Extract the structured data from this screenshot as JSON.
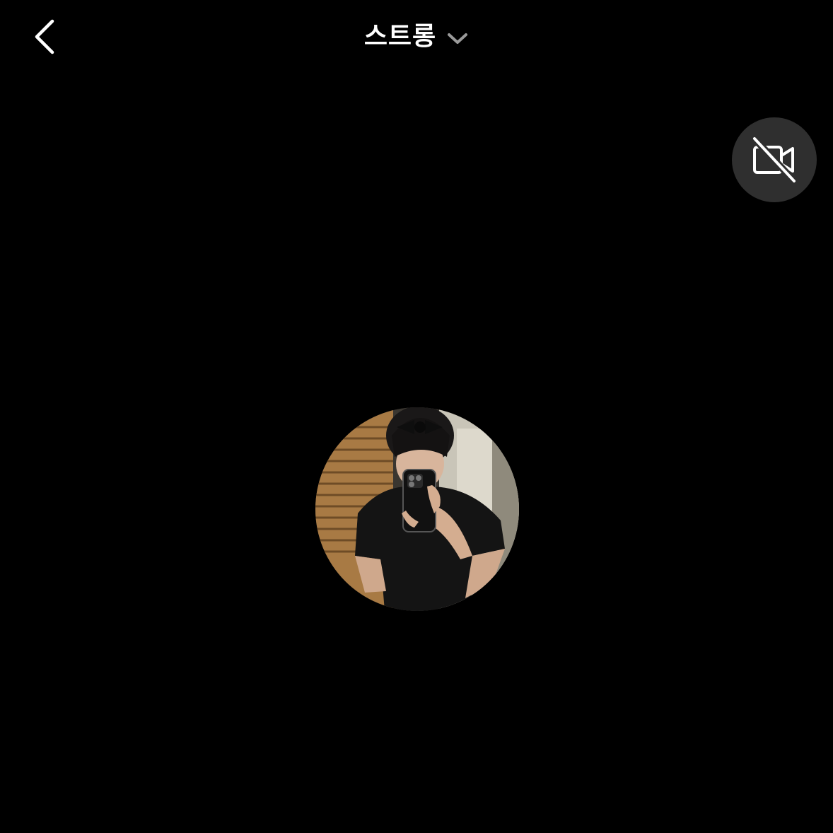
{
  "header": {
    "title": "스트롱",
    "back_icon": "chevron-left-icon",
    "dropdown_icon": "chevron-down-icon"
  },
  "controls": {
    "camera_toggle_icon": "video-off-icon",
    "camera_enabled": false
  },
  "colors": {
    "background": "#000000",
    "text": "#ffffff",
    "chevron": "#9a9a9a",
    "control_bg": "#2f2f2f"
  }
}
